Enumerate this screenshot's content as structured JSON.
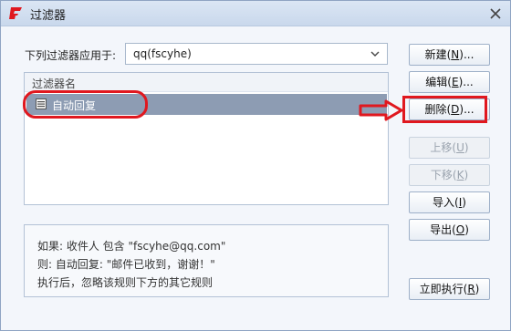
{
  "window": {
    "title": "过滤器"
  },
  "apply_to": {
    "label": "下列过滤器应用于:",
    "account": "qq(fscyhe)"
  },
  "list": {
    "header": "过滤器名",
    "items": [
      {
        "label": "自动回复",
        "selected": true
      }
    ]
  },
  "buttons": {
    "new": {
      "text": "新建(",
      "key": "N",
      "suffix": ")..."
    },
    "edit": {
      "text": "编辑(",
      "key": "E",
      "suffix": ")..."
    },
    "delete": {
      "text": "删除(",
      "key": "D",
      "suffix": ")..."
    },
    "up": {
      "text": "上移(",
      "key": "U",
      "suffix": ")"
    },
    "down": {
      "text": "下移(",
      "key": "K",
      "suffix": ")"
    },
    "import": {
      "text": "导入(",
      "key": "I",
      "suffix": ")"
    },
    "export": {
      "text": "导出(",
      "key": "O",
      "suffix": ")"
    },
    "run": {
      "text": "立即执行(",
      "key": "R",
      "suffix": ")"
    }
  },
  "description": {
    "line1": "如果: 收件人 包含 \"fscyhe@qq.com\"",
    "line2": "则: 自动回复: \"邮件已收到，谢谢！\"",
    "line3": "执行后，忽略该规则下方的其它规则"
  },
  "colors": {
    "annotation": "#e0181f",
    "selected_row": "#8d9cb3",
    "app_icon": "#e0181f"
  }
}
